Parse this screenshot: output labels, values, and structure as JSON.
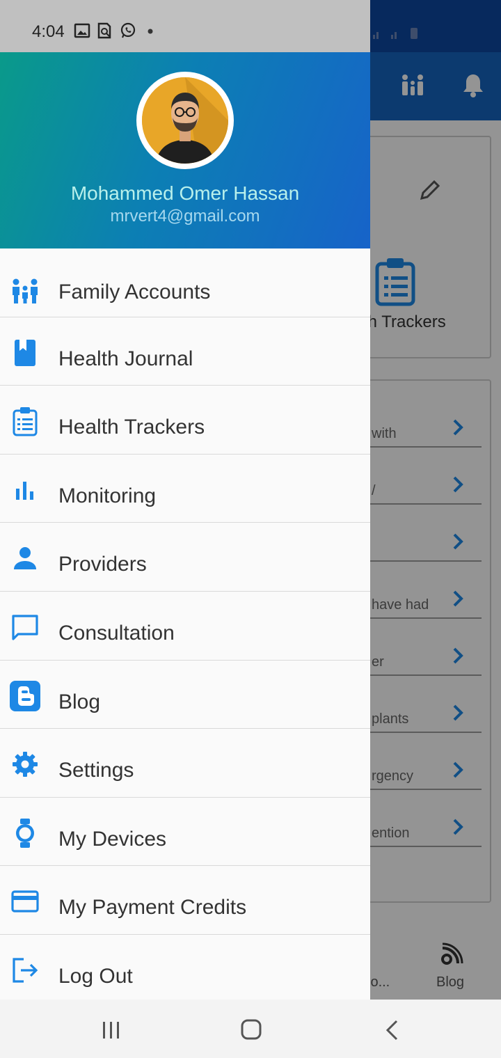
{
  "status_bar": {
    "time": "4:04"
  },
  "background_app": {
    "card_label": "th Trackers",
    "rows": [
      "with",
      "/",
      "",
      "have had",
      "er",
      "plants",
      "rgency",
      "ention"
    ],
    "bottom_nav_cut": "io...",
    "bottom_nav_blog": "Blog"
  },
  "user": {
    "name": "Mohammed Omer Hassan",
    "email": "mrvert4@gmail.com"
  },
  "menu": [
    {
      "label": "Family Accounts",
      "icon": "family-icon"
    },
    {
      "label": "Health Journal",
      "icon": "journal-icon"
    },
    {
      "label": "Health Trackers",
      "icon": "clipboard-list-icon"
    },
    {
      "label": "Monitoring",
      "icon": "bar-chart-icon"
    },
    {
      "label": "Providers",
      "icon": "person-icon"
    },
    {
      "label": "Consultation",
      "icon": "chat-bubble-icon"
    },
    {
      "label": "Blog",
      "icon": "blogger-icon"
    },
    {
      "label": "Settings",
      "icon": "gear-icon"
    },
    {
      "label": "My Devices",
      "icon": "watch-icon"
    },
    {
      "label": "My Payment Credits",
      "icon": "credit-card-icon"
    },
    {
      "label": "Log Out",
      "icon": "logout-icon"
    }
  ],
  "colors": {
    "accent": "#1e88e5",
    "header_gradient_start": "#0a9a8a",
    "header_gradient_end": "#1763c9",
    "app_bar": "#1565c0"
  }
}
